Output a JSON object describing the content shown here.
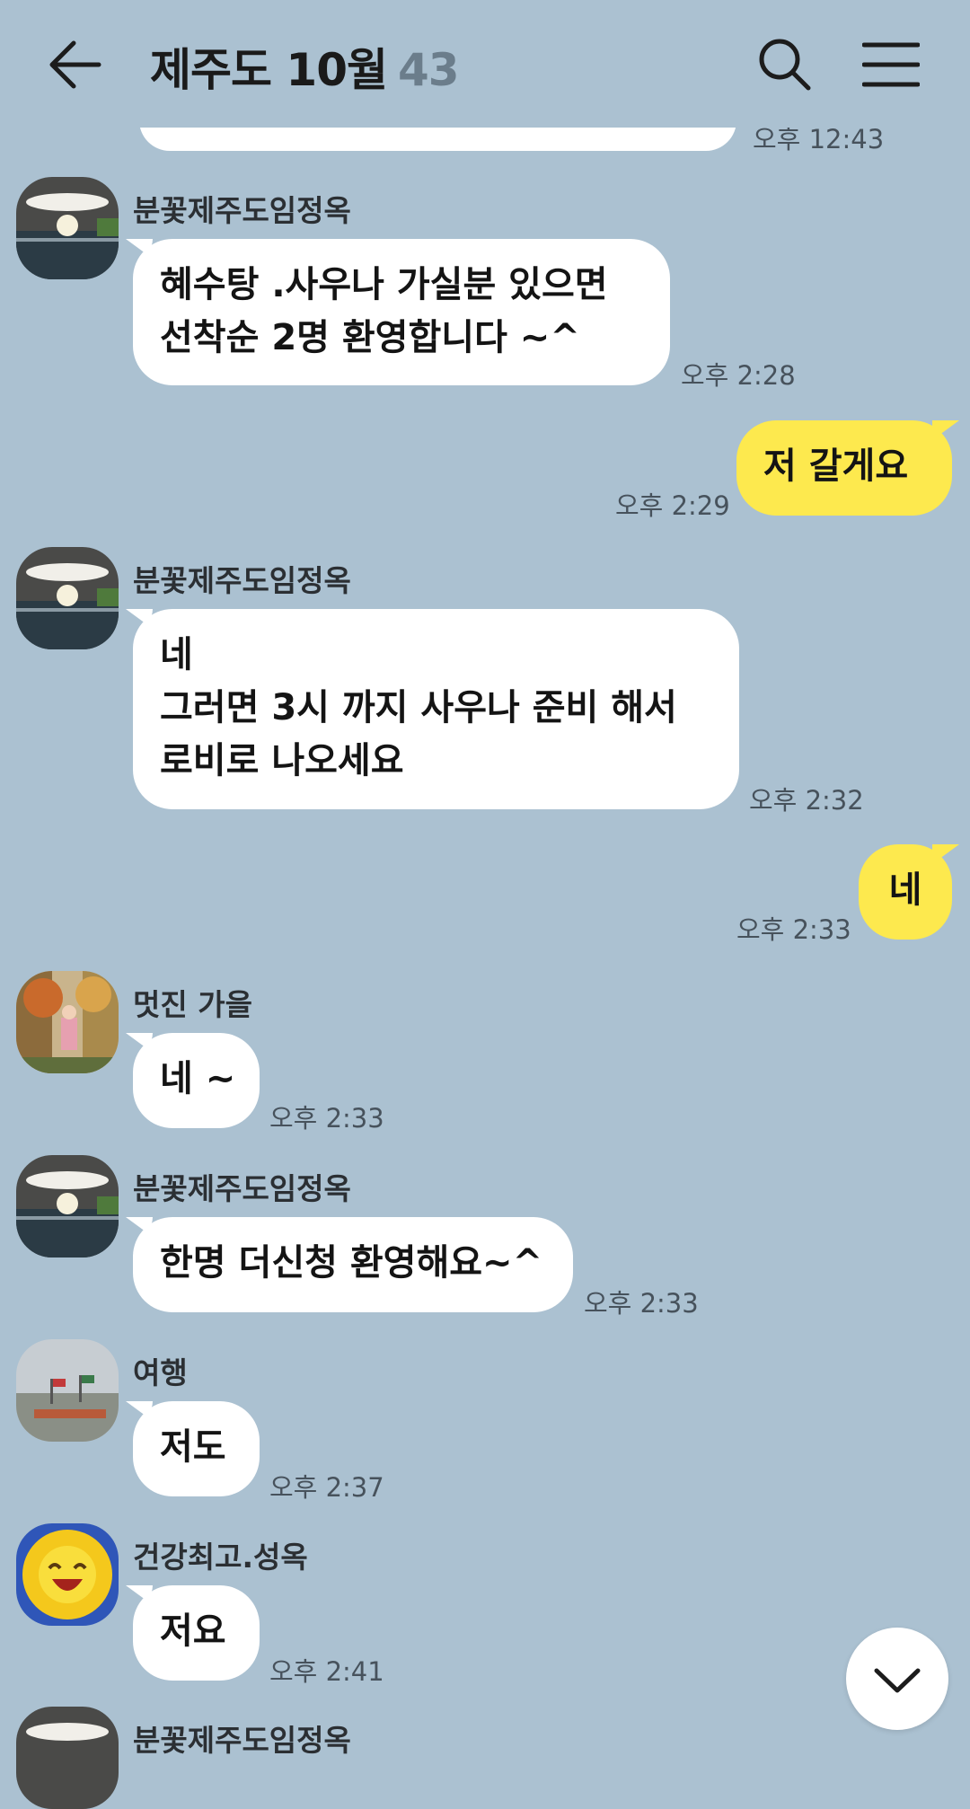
{
  "header": {
    "title": "제주도 10월",
    "member_count": "43",
    "back_icon": "arrow-left-icon",
    "search_icon": "search-icon",
    "menu_icon": "hamburger-menu-icon"
  },
  "prev_message": {
    "time": "오후 12:43"
  },
  "messages": [
    {
      "sender": "분꽃제주도임정옥",
      "lines": [
        "혜수탕  .사우나 가실분 있으면",
        "선착순 2명 환영합니다 ~^"
      ],
      "time": "오후 2:28"
    },
    {
      "outgoing": true,
      "lines": [
        "저 갈게요"
      ],
      "time": "오후 2:29"
    },
    {
      "sender": "분꽃제주도임정옥",
      "lines": [
        "네",
        "그러면 3시 까지 사우나 준비 해서",
        "로비로  나오세요"
      ],
      "time": "오후 2:32"
    },
    {
      "outgoing": true,
      "lines": [
        "네"
      ],
      "time": "오후 2:33"
    },
    {
      "sender": "멋진 가을",
      "lines": [
        "네 ~"
      ],
      "time": "오후 2:33"
    },
    {
      "sender": "분꽃제주도임정옥",
      "lines": [
        "한명 더신청 환영해요~^"
      ],
      "time": "오후 2:33"
    },
    {
      "sender": "여행",
      "lines": [
        "저도"
      ],
      "time": "오후 2:37"
    },
    {
      "sender": "건강최고.성옥",
      "lines": [
        "저요"
      ],
      "time": "오후 2:41"
    },
    {
      "sender": "분꽃제주도임정옥"
    }
  ],
  "scroll_down_icon": "chevron-down-icon",
  "colors": {
    "background": "#abc1d1",
    "outgoing_bubble": "#fde94e",
    "incoming_bubble": "#ffffff"
  }
}
